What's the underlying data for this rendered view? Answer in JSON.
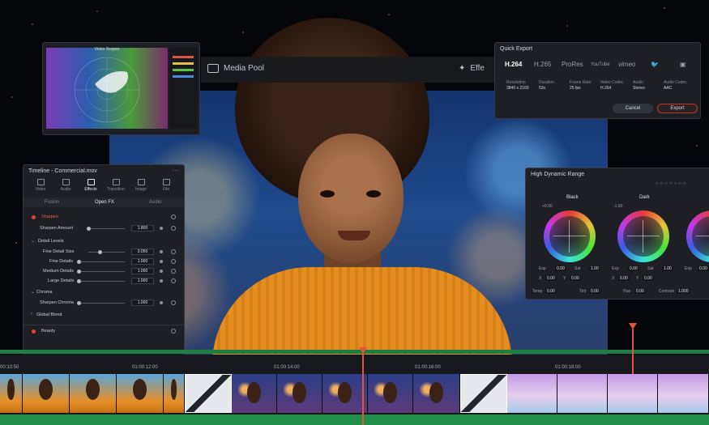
{
  "nav": {
    "media_pool": "Media Pool",
    "effects": "Effe"
  },
  "scope": {
    "title": "Video Scopes"
  },
  "quick_export": {
    "title": "Quick Export",
    "tabs": [
      "H.264",
      "H.265",
      "ProRes",
      "YouTube",
      "vimeo",
      "Twitter",
      ""
    ],
    "active_tab": "H.264",
    "fields": [
      {
        "label": "Resolution",
        "value": "3840 x 2160"
      },
      {
        "label": "Duration",
        "value": "53s"
      },
      {
        "label": "Frame Rate",
        "value": "25 fps"
      },
      {
        "label": "Video Codec",
        "value": "H.264"
      },
      {
        "label": "Audio",
        "value": "Stereo"
      },
      {
        "label": "Audio Codec",
        "value": "AAC"
      }
    ],
    "cancel_label": "Cancel",
    "export_label": "Export"
  },
  "inspector": {
    "title": "Timeline - Commercial.mov",
    "tabs": [
      "Video",
      "Audio",
      "Effects",
      "Transition",
      "Image",
      "File"
    ],
    "active_tab": "Effects",
    "subtabs": [
      "Fusion",
      "Open FX",
      "Audio"
    ],
    "active_subtab": "Open FX",
    "sharpen": {
      "label": "Sharpen",
      "amount_label": "Sharpen Amount",
      "amount": "1.800"
    },
    "detail_levels": {
      "label": "Detail Levels",
      "rows": [
        {
          "label": "Fine Detail Size",
          "value": "0.050"
        },
        {
          "label": "Fine Details",
          "value": "1.000"
        },
        {
          "label": "Medium Details",
          "value": "1.000"
        },
        {
          "label": "Large Details",
          "value": "1.000"
        }
      ]
    },
    "chroma": {
      "label": "Chroma",
      "sharpen_chroma_label": "Sharpen Chroma",
      "sharpen_chroma": "1.000"
    },
    "global_blend": "Global Blend",
    "beauty": "Beauty"
  },
  "hdr": {
    "title": "High Dynamic Range",
    "wheels": [
      {
        "label": "Black",
        "top": "+0.00",
        "exp": "0.00",
        "sat": "1.00",
        "x": "0.00",
        "y": "0.00"
      },
      {
        "label": "Dark",
        "top": "-1.50",
        "exp": "0.00",
        "sat": "1.00",
        "x": "0.00",
        "y": "0.00"
      },
      {
        "label": "",
        "top": "",
        "exp": "0.00",
        "sat": "",
        "x": "",
        "y": ""
      }
    ],
    "labels": {
      "exp": "Exp",
      "sat": "Sat",
      "x": "X",
      "y": "Y"
    },
    "bottom": [
      {
        "label": "Temp",
        "value": "0.00"
      },
      {
        "label": "Tint",
        "value": "0.00"
      },
      {
        "label": "Hue",
        "value": "0.00"
      },
      {
        "label": "Contrast",
        "value": "1.000"
      }
    ]
  },
  "timeline": {
    "timecodes": [
      "00:10:50",
      "01:00:12:00",
      "01:00:14:00",
      "01:00:16:00",
      "01:00:18:00"
    ]
  },
  "colors": {
    "accent_red": "#e5533a",
    "audio_green": "#1f8f4a",
    "panel_bg": "#1d1f24"
  }
}
